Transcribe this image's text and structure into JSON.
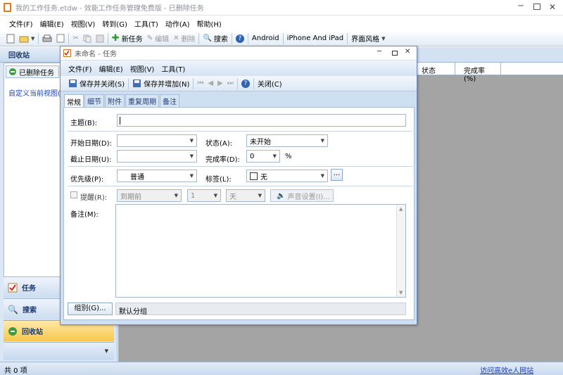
{
  "app": {
    "title": "我的工作任务.etdw - 效能工作任务管理免费版 - 已删除任务",
    "menu": [
      "文件(F)",
      "编辑(E)",
      "视图(V)",
      "转到(G)",
      "工具(T)",
      "动作(A)",
      "帮助(H)"
    ],
    "toolbar": {
      "new_task": "新任务",
      "edit": "编辑",
      "delete": "删除",
      "search": "搜索",
      "android": "Android",
      "iphone": "iPhone And iPad",
      "theme": "界面风格"
    }
  },
  "sidebar": {
    "header": "回收站",
    "tab": "已删除任务",
    "custom_view": "自定义当前视图(",
    "nav": [
      "任务",
      "搜索",
      "回收站"
    ]
  },
  "grid": {
    "columns": [
      "状态",
      "完成率(%)"
    ]
  },
  "status_bar": {
    "count": "共 0 项",
    "link": "访问高效e人网站"
  },
  "dialog": {
    "title": "未命名 - 任务",
    "menu": [
      "文件(F)",
      "编辑(E)",
      "视图(V)",
      "工具(T)"
    ],
    "toolbar": {
      "save_close": "保存并关闭(S)",
      "save_new": "保存并增加(N)",
      "close": "关闭(C)"
    },
    "tabs": [
      "常规",
      "细节",
      "附件",
      "重复周期",
      "备注"
    ],
    "form": {
      "subject_label": "主题(B):",
      "subject_value": "",
      "start_label": "开始日期(D):",
      "start_value": "",
      "status_label": "状态(A):",
      "status_value": "未开始",
      "due_label": "截止日期(U):",
      "due_value": "",
      "complete_label": "完成率(D):",
      "complete_value": "0",
      "percent": "%",
      "priority_label": "优先级(P):",
      "priority_value": "普通",
      "tag_label": "标签(L):",
      "tag_value": "无",
      "ellipsis": "...",
      "reminder_label": "提醒(R):",
      "reminder_when": "到期前",
      "reminder_num": "1",
      "reminder_unit": "天",
      "sound_button": "声音设置(I)...",
      "notes_label": "备注(M):",
      "group_button": "组别(G)...",
      "group_value": "默认分组"
    }
  }
}
